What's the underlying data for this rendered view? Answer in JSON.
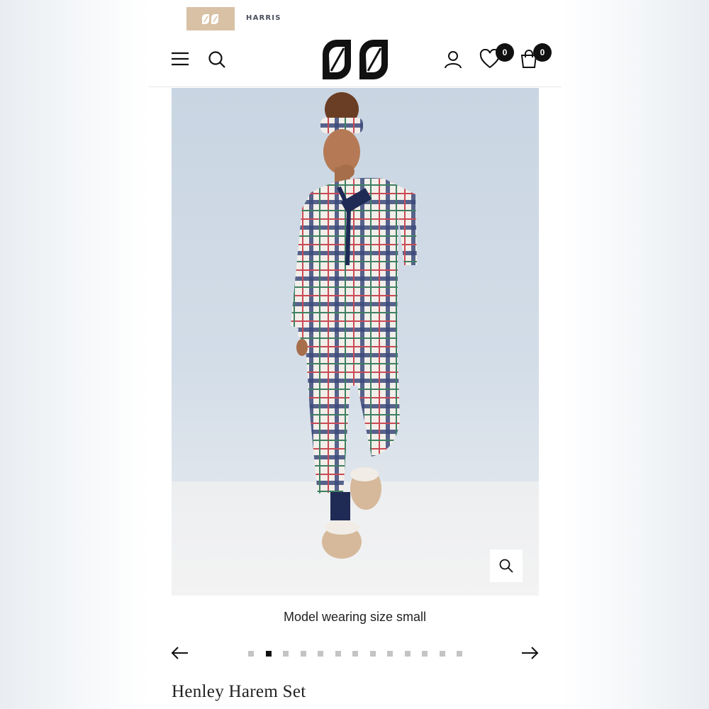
{
  "brand_strip": {
    "store_name": "HARRIS"
  },
  "header": {
    "logo_icon": "leaf-pair-logo",
    "menu_icon": "hamburger-icon",
    "search_icon": "search-icon",
    "account_icon": "user-icon",
    "wishlist_icon": "heart-icon",
    "wishlist_count": "0",
    "cart_icon": "shopping-bag-icon",
    "cart_count": "0"
  },
  "gallery": {
    "caption": "Model wearing size small",
    "zoom_icon": "zoom-icon",
    "prev_icon": "arrow-left-icon",
    "next_icon": "arrow-right-icon",
    "slide_count": 13,
    "active_index": 1
  },
  "product": {
    "title": "Henley Harem Set"
  },
  "colors": {
    "brand_tab": "#d8c1a5",
    "badge": "#111111",
    "dot_active": "#111111",
    "dot_inactive": "#c4c4c4"
  }
}
